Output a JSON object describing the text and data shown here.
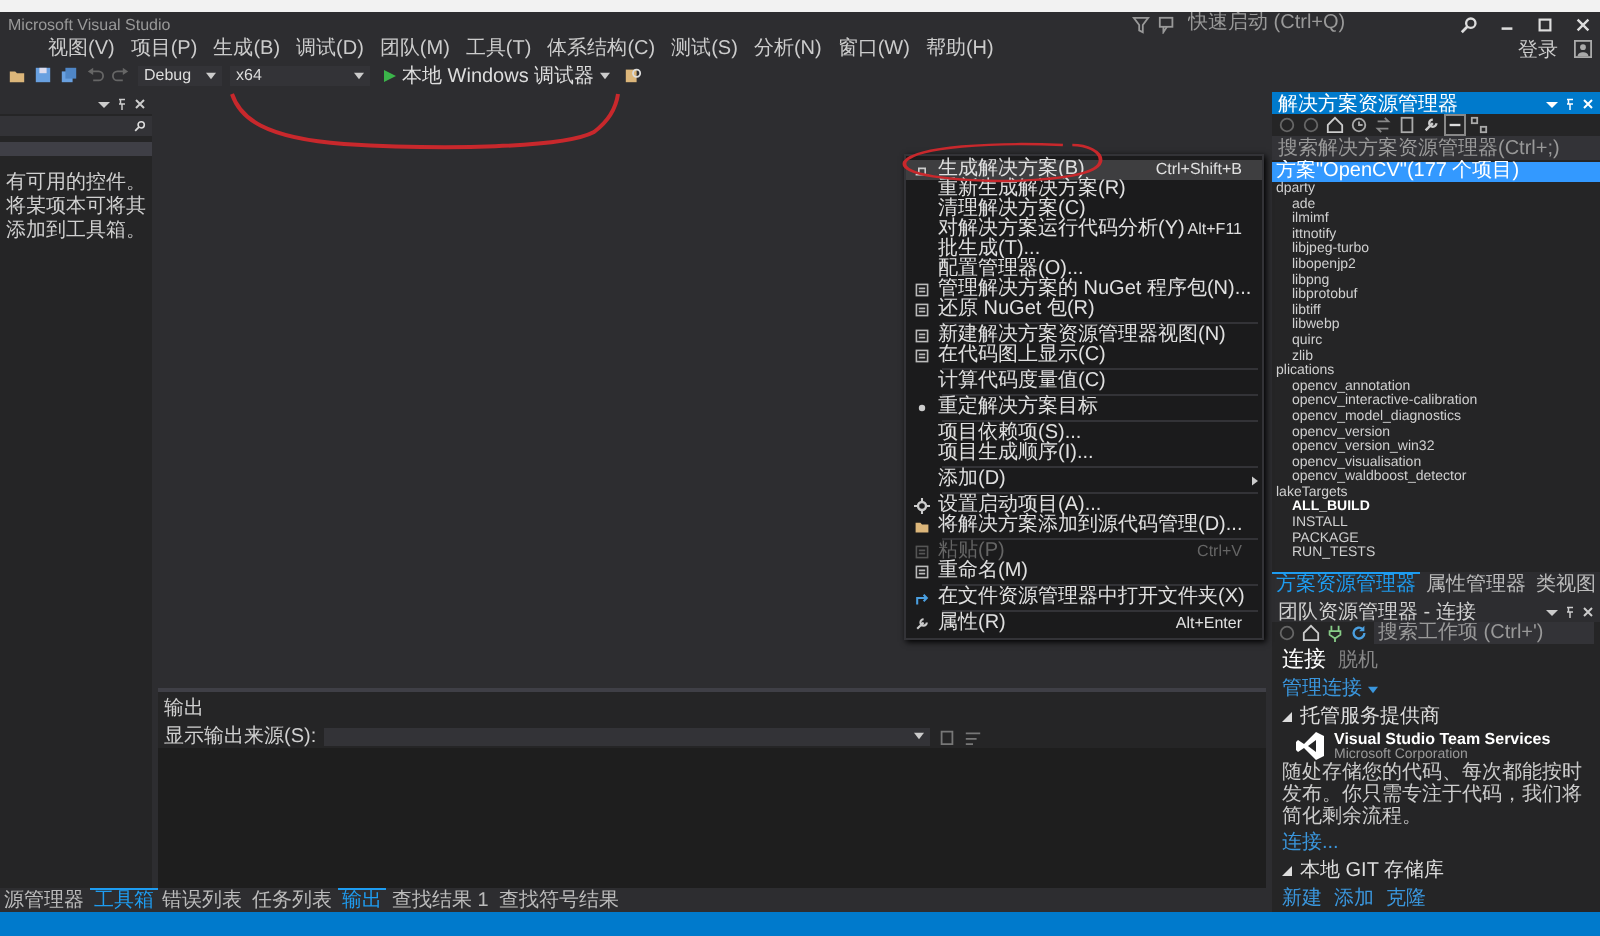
{
  "title_bar": {
    "title": "Microsoft Visual Studio",
    "quick_launch": {
      "placeholder": "快速启动 (Ctrl+Q)"
    }
  },
  "menu_bar": {
    "items": [
      "视图(V)",
      "项目(P)",
      "生成(B)",
      "调试(D)",
      "团队(M)",
      "工具(T)",
      "体系结构(C)",
      "测试(S)",
      "分析(N)",
      "窗口(W)",
      "帮助(H)"
    ],
    "sign_in": "登录"
  },
  "toolbar": {
    "configuration": "Debug",
    "platform": "x64",
    "run_button": "本地 Windows 调试器"
  },
  "toolbox": {
    "message": "有可用的控件。将某项本可将其添加到工具箱。",
    "tabs": [
      {
        "label": "源管理器",
        "selected": false
      },
      {
        "label": "工具箱",
        "selected": true
      }
    ]
  },
  "output": {
    "title": "输出",
    "source_label": "显示输出来源(S):",
    "tabs": [
      {
        "label": "错误列表",
        "selected": false
      },
      {
        "label": "任务列表",
        "selected": false
      },
      {
        "label": "输出",
        "selected": true
      },
      {
        "label": "查找结果 1",
        "selected": false
      },
      {
        "label": "查找符号结果",
        "selected": false
      }
    ]
  },
  "context_menu": {
    "items": [
      {
        "kind": "item",
        "label": "生成解决方案(B)",
        "shortcut": "Ctrl+Shift+B",
        "disabled": false,
        "submenu": false,
        "selected": true
      },
      {
        "kind": "item",
        "label": "重新生成解决方案(R)",
        "disabled": false,
        "submenu": false,
        "selected": false
      },
      {
        "kind": "item",
        "label": "清理解决方案(C)",
        "disabled": false,
        "submenu": false,
        "selected": false
      },
      {
        "kind": "item",
        "label": "对解决方案运行代码分析(Y)",
        "shortcut": "Alt+F11",
        "disabled": false,
        "submenu": false,
        "selected": false
      },
      {
        "kind": "item",
        "label": "批生成(T)...",
        "disabled": false,
        "submenu": false,
        "selected": false
      },
      {
        "kind": "item",
        "label": "配置管理器(O)...",
        "disabled": false,
        "submenu": false,
        "selected": false
      },
      {
        "kind": "item",
        "label": "管理解决方案的 NuGet 程序包(N)...",
        "disabled": false,
        "submenu": false,
        "selected": false
      },
      {
        "kind": "item",
        "label": "还原 NuGet 包(R)",
        "disabled": false,
        "submenu": false,
        "selected": false
      },
      {
        "kind": "separator"
      },
      {
        "kind": "item",
        "label": "新建解决方案资源管理器视图(N)",
        "disabled": false,
        "submenu": false,
        "selected": false
      },
      {
        "kind": "item",
        "label": "在代码图上显示(C)",
        "disabled": false,
        "submenu": false,
        "selected": false
      },
      {
        "kind": "separator"
      },
      {
        "kind": "item",
        "label": "计算代码度量值(C)",
        "disabled": false,
        "submenu": false,
        "selected": false
      },
      {
        "kind": "separator"
      },
      {
        "kind": "item",
        "label": "重定解决方案目标",
        "disabled": false,
        "submenu": false,
        "selected": false
      },
      {
        "kind": "separator"
      },
      {
        "kind": "item",
        "label": "项目依赖项(S)...",
        "disabled": false,
        "submenu": false,
        "selected": false
      },
      {
        "kind": "item",
        "label": "项目生成顺序(I)...",
        "disabled": false,
        "submenu": false,
        "selected": false
      },
      {
        "kind": "separator"
      },
      {
        "kind": "item",
        "label": "添加(D)",
        "disabled": false,
        "submenu": true,
        "selected": false
      },
      {
        "kind": "separator"
      },
      {
        "kind": "item",
        "label": "设置启动项目(A)...",
        "disabled": false,
        "submenu": false,
        "selected": false
      },
      {
        "kind": "item",
        "label": "将解决方案添加到源代码管理(D)...",
        "disabled": false,
        "submenu": false,
        "selected": false
      },
      {
        "kind": "separator"
      },
      {
        "kind": "item",
        "label": "粘贴(P)",
        "shortcut": "Ctrl+V",
        "disabled": true,
        "submenu": false,
        "selected": false
      },
      {
        "kind": "item",
        "label": "重命名(M)",
        "disabled": false,
        "submenu": false,
        "selected": false
      },
      {
        "kind": "separator"
      },
      {
        "kind": "item",
        "label": "在文件资源管理器中打开文件夹(X)",
        "disabled": false,
        "submenu": false,
        "selected": false
      },
      {
        "kind": "separator"
      },
      {
        "kind": "item",
        "label": "属性(R)",
        "shortcut": "Alt+Enter",
        "disabled": false,
        "submenu": false,
        "selected": false
      }
    ]
  },
  "solution_explorer": {
    "title": "解决方案资源管理器",
    "search": {
      "placeholder": "搜索解决方案资源管理器(Ctrl+;)"
    },
    "tree": [
      {
        "label": "方案\"OpenCV\"(177 个项目)",
        "selected": true
      },
      {
        "label": "dparty",
        "selected": false,
        "children": [
          {
            "label": "ade",
            "selected": false,
            "startup": false
          },
          {
            "label": "ilmimf",
            "selected": false,
            "startup": false
          },
          {
            "label": "ittnotify",
            "selected": false,
            "startup": false
          },
          {
            "label": "libjpeg-turbo",
            "selected": false,
            "startup": false
          },
          {
            "label": "libopenjp2",
            "selected": false,
            "startup": false
          },
          {
            "label": "libpng",
            "selected": false,
            "startup": false
          },
          {
            "label": "libprotobuf",
            "selected": false,
            "startup": false
          },
          {
            "label": "libtiff",
            "selected": false,
            "startup": false
          },
          {
            "label": "libwebp",
            "selected": false,
            "startup": false
          },
          {
            "label": "quirc",
            "selected": false,
            "startup": false
          },
          {
            "label": "zlib",
            "selected": false,
            "startup": false
          }
        ]
      },
      {
        "label": "plications",
        "selected": false,
        "children": [
          {
            "label": "opencv_annotation",
            "selected": false,
            "startup": false
          },
          {
            "label": "opencv_interactive-calibration",
            "selected": false,
            "startup": false
          },
          {
            "label": "opencv_model_diagnostics",
            "selected": false,
            "startup": false
          },
          {
            "label": "opencv_version",
            "selected": false,
            "startup": false
          },
          {
            "label": "opencv_version_win32",
            "selected": false,
            "startup": false
          },
          {
            "label": "opencv_visualisation",
            "selected": false,
            "startup": false
          },
          {
            "label": "opencv_waldboost_detector",
            "selected": false,
            "startup": false
          }
        ]
      },
      {
        "label": "lakeTargets",
        "selected": false,
        "children": [
          {
            "label": "ALL_BUILD",
            "selected": false,
            "startup": true
          },
          {
            "label": "INSTALL",
            "selected": false,
            "startup": false
          },
          {
            "label": "PACKAGE",
            "selected": false,
            "startup": false
          },
          {
            "label": "RUN_TESTS",
            "selected": false,
            "startup": false
          }
        ]
      }
    ],
    "tabs": [
      {
        "label": "方案资源管理器",
        "selected": true
      },
      {
        "label": "属性管理器",
        "selected": false
      },
      {
        "label": "类视图",
        "selected": false
      }
    ]
  },
  "team_explorer": {
    "title": "团队资源管理器 - 连接",
    "search": {
      "placeholder": "搜索工作项 (Ctrl+')"
    },
    "tabs": [
      {
        "label": "连接",
        "selected": true
      },
      {
        "label": "脱机",
        "selected": false
      }
    ],
    "manage_link": "管理连接",
    "hosted_section": "托管服务提供商",
    "service": {
      "name": "Visual Studio Team Services",
      "publisher": "Microsoft Corporation",
      "description": "随处存储您的代码、每次都能按时发布。你只需专注于代码，我们将简化剩余流程。",
      "connect_link": "连接..."
    },
    "git_section": "本地 GIT 存储库",
    "git_links": [
      "新建",
      "添加",
      "克隆"
    ]
  }
}
